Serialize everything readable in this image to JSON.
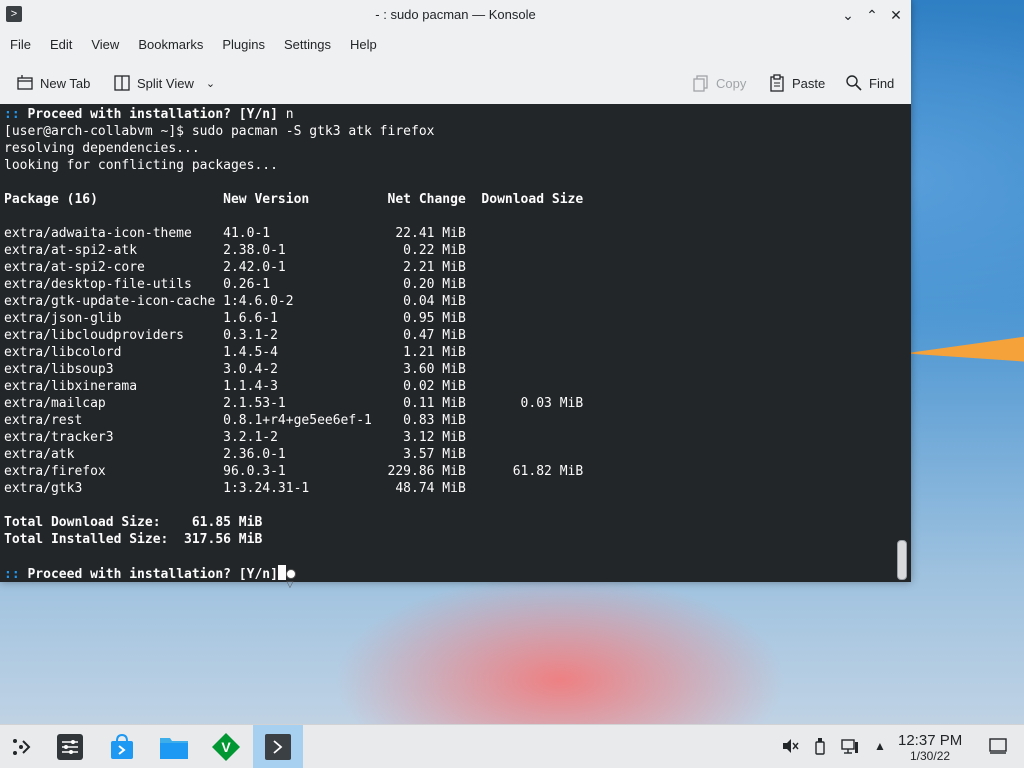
{
  "window": {
    "title": "- : sudo pacman — Konsole"
  },
  "menubar": {
    "items": [
      "File",
      "Edit",
      "View",
      "Bookmarks",
      "Plugins",
      "Settings",
      "Help"
    ]
  },
  "toolbar": {
    "new_tab": "New Tab",
    "split_view": "Split View",
    "copy": "Copy",
    "paste": "Paste",
    "find": "Find"
  },
  "terminal": {
    "lines": [
      {
        "text": ":: Proceed with installation? [Y/n] n",
        "style": "prompt"
      },
      {
        "text": "[user@arch-collabvm ~]$ sudo pacman -S gtk3 atk firefox",
        "style": "normal"
      },
      {
        "text": "resolving dependencies...",
        "style": "normal"
      },
      {
        "text": "looking for conflicting packages...",
        "style": "normal"
      },
      {
        "text": "",
        "style": "normal"
      },
      {
        "text": "Package (16)                New Version          Net Change  Download Size",
        "style": "bold"
      },
      {
        "text": "",
        "style": "normal"
      },
      {
        "text": "extra/adwaita-icon-theme    41.0-1                22.41 MiB",
        "style": "normal"
      },
      {
        "text": "extra/at-spi2-atk           2.38.0-1               0.22 MiB",
        "style": "normal"
      },
      {
        "text": "extra/at-spi2-core          2.42.0-1               2.21 MiB",
        "style": "normal"
      },
      {
        "text": "extra/desktop-file-utils    0.26-1                 0.20 MiB",
        "style": "normal"
      },
      {
        "text": "extra/gtk-update-icon-cache 1:4.6.0-2              0.04 MiB",
        "style": "normal"
      },
      {
        "text": "extra/json-glib             1.6.6-1                0.95 MiB",
        "style": "normal"
      },
      {
        "text": "extra/libcloudproviders     0.3.1-2                0.47 MiB",
        "style": "normal"
      },
      {
        "text": "extra/libcolord             1.4.5-4                1.21 MiB",
        "style": "normal"
      },
      {
        "text": "extra/libsoup3              3.0.4-2                3.60 MiB",
        "style": "normal"
      },
      {
        "text": "extra/libxinerama           1.1.4-3                0.02 MiB",
        "style": "normal"
      },
      {
        "text": "extra/mailcap               2.1.53-1               0.11 MiB       0.03 MiB",
        "style": "normal"
      },
      {
        "text": "extra/rest                  0.8.1+r4+ge5ee6ef-1    0.83 MiB",
        "style": "normal"
      },
      {
        "text": "extra/tracker3              3.2.1-2                3.12 MiB",
        "style": "normal"
      },
      {
        "text": "extra/atk                   2.36.0-1               3.57 MiB",
        "style": "normal"
      },
      {
        "text": "extra/firefox               96.0.3-1             229.86 MiB      61.82 MiB",
        "style": "normal"
      },
      {
        "text": "extra/gtk3                  1:3.24.31-1           48.74 MiB",
        "style": "normal"
      },
      {
        "text": "",
        "style": "normal"
      },
      {
        "text": "Total Download Size:    61.85 MiB",
        "style": "bold"
      },
      {
        "text": "Total Installed Size:  317.56 MiB",
        "style": "bold"
      },
      {
        "text": "",
        "style": "normal"
      },
      {
        "text": ":: Proceed with installation? [Y/n]",
        "style": "prompt-cursor"
      }
    ]
  },
  "taskbar": {
    "clock_time": "12:37 PM",
    "clock_date": "1/30/22"
  }
}
